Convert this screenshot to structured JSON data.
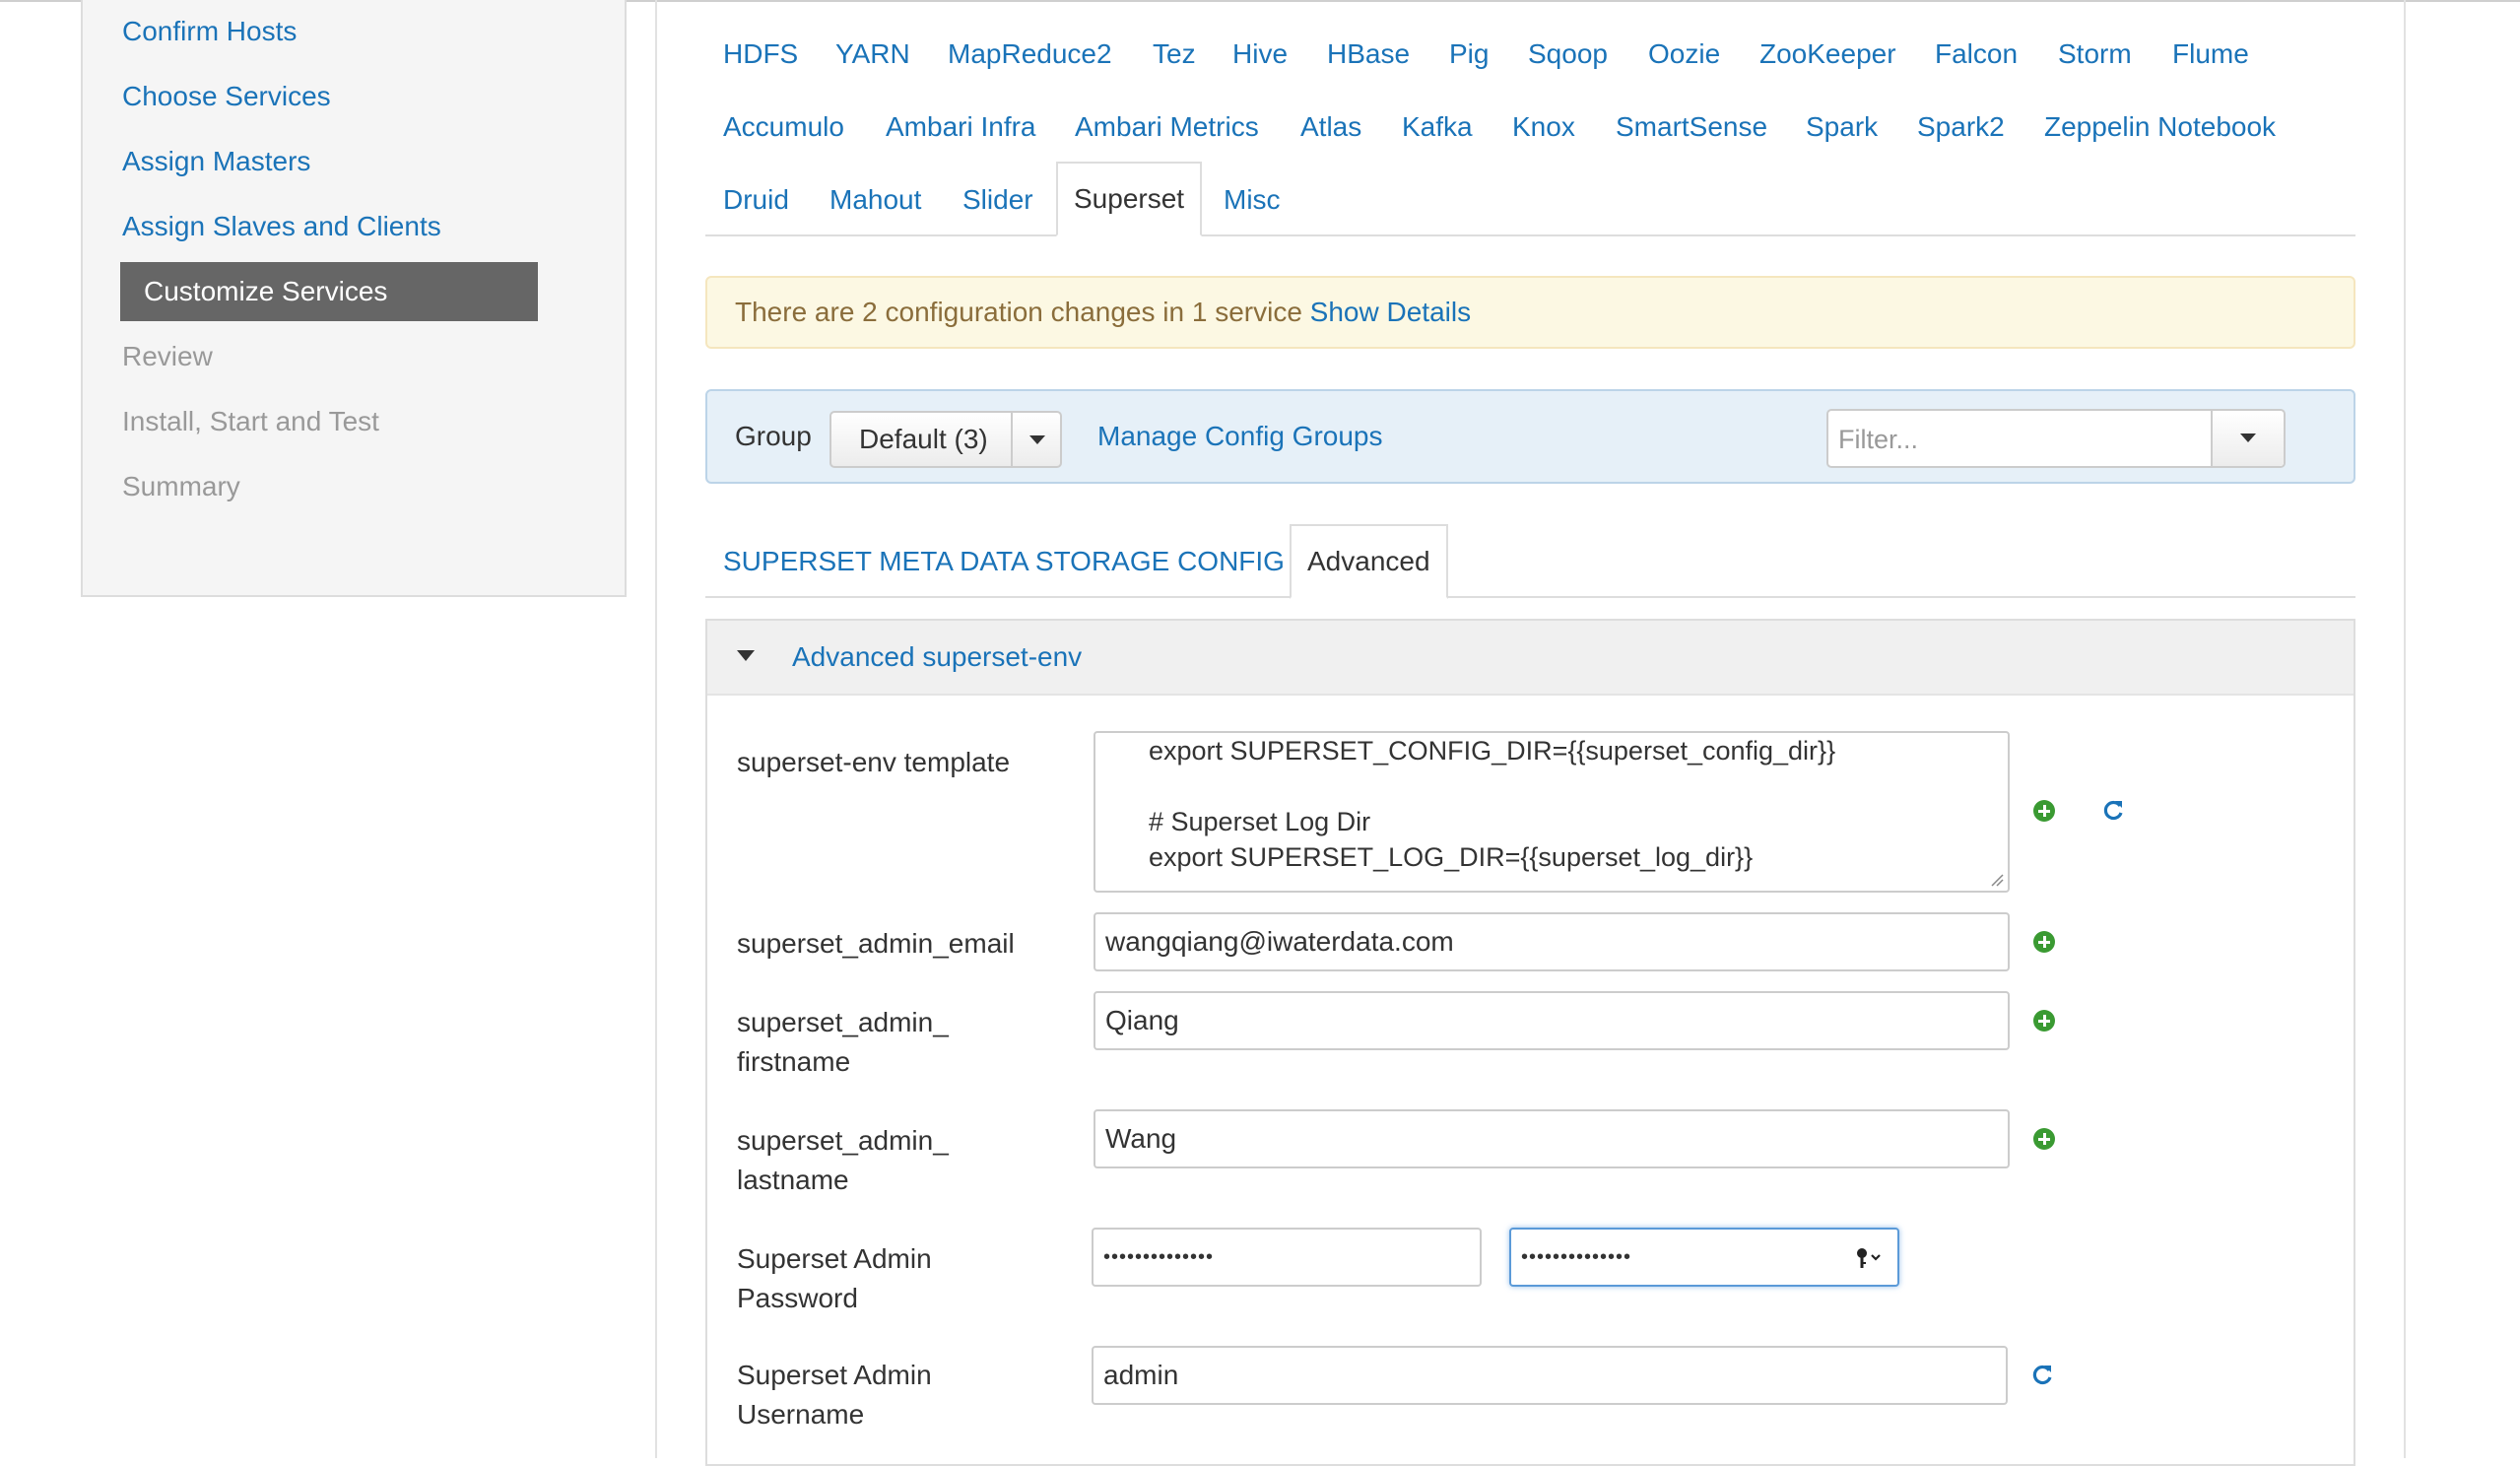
{
  "sidebar": {
    "steps": [
      {
        "label": "Confirm Hosts",
        "state": "done"
      },
      {
        "label": "Choose Services",
        "state": "done"
      },
      {
        "label": "Assign Masters",
        "state": "done"
      },
      {
        "label": "Assign Slaves and Clients",
        "state": "done"
      },
      {
        "label": "Customize Services",
        "state": "active"
      },
      {
        "label": "Review",
        "state": "disabled"
      },
      {
        "label": "Install, Start and Test",
        "state": "disabled"
      },
      {
        "label": "Summary",
        "state": "disabled"
      }
    ]
  },
  "service_tabs": {
    "row1": [
      "HDFS",
      "YARN",
      "MapReduce2",
      "Tez",
      "Hive",
      "HBase",
      "Pig",
      "Sqoop",
      "Oozie",
      "ZooKeeper",
      "Falcon",
      "Storm",
      "Flume"
    ],
    "row2": [
      "Accumulo",
      "Ambari Infra",
      "Ambari Metrics",
      "Atlas",
      "Kafka",
      "Knox",
      "SmartSense",
      "Spark",
      "Spark2",
      "Zeppelin Notebook"
    ],
    "row3": [
      "Druid",
      "Mahout",
      "Slider",
      "Superset",
      "Misc"
    ],
    "active": "Superset"
  },
  "alert": {
    "text": "There are 2 configuration changes in 1 service",
    "link": "Show Details"
  },
  "group_bar": {
    "label": "Group",
    "selected": "Default (3)",
    "manage_link": "Manage Config Groups",
    "filter_placeholder": "Filter..."
  },
  "sub_tabs": {
    "items": [
      "SUPERSET META DATA STORAGE CONFIG",
      "Advanced"
    ],
    "active": "Advanced"
  },
  "section": {
    "title": "Advanced superset-env",
    "env_template": {
      "label": "superset-env template",
      "lines": [
        "export SUPERSET_CONFIG_DIR={{superset_config_dir}}",
        "",
        "# Superset Log Dir",
        "export SUPERSET_LOG_DIR={{superset_log_dir}}"
      ]
    },
    "admin_email": {
      "label": "superset_admin_email",
      "value": "wangqiang@iwaterdata.com"
    },
    "admin_firstname": {
      "label_line1": "superset_admin_",
      "label_line2": "firstname",
      "value": "Qiang"
    },
    "admin_lastname": {
      "label_line1": "superset_admin_",
      "label_line2": "lastname",
      "value": "Wang"
    },
    "admin_password": {
      "label_line1": "Superset Admin",
      "label_line2": "Password",
      "value": "••••••••••••••",
      "confirm_value": "••••••••••••••"
    },
    "admin_username": {
      "label_line1": "Superset Admin",
      "label_line2": "Username",
      "value": "admin"
    }
  },
  "colors": {
    "link": "#1a73b8",
    "active_step_bg": "#666666",
    "alert_bg": "#fcf8e3",
    "groupbar_bg": "#e6f0f8",
    "add_icon": "#3a9a32"
  }
}
